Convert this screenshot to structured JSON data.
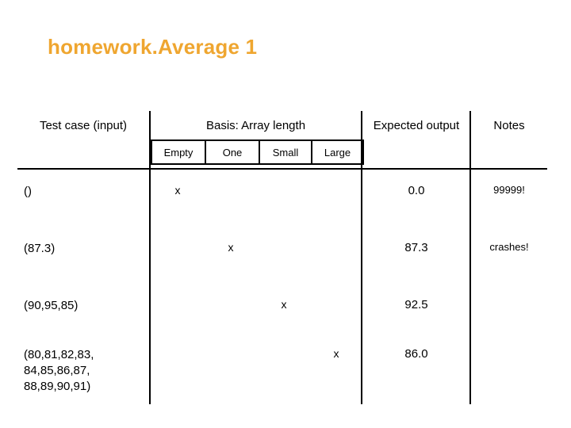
{
  "slide": {
    "title": "homework.Average 1",
    "title_color": "#efa630"
  },
  "table": {
    "headers": {
      "test_case": "Test case\n(input)",
      "basis": "Basis: Array length",
      "expected_output": "Expected\noutput",
      "notes": "Notes"
    },
    "basis_columns": [
      {
        "key": "empty",
        "label": "Empty"
      },
      {
        "key": "one",
        "label": "One"
      },
      {
        "key": "small",
        "label": "Small"
      },
      {
        "key": "large",
        "label": "Large"
      }
    ],
    "mark_glyph": "x",
    "rows": [
      {
        "test_case": "()",
        "basis": "empty",
        "marks": {
          "empty": "x",
          "one": "",
          "small": "",
          "large": ""
        },
        "expected_output": "0.0",
        "notes": "99999!"
      },
      {
        "test_case": "(87.3)",
        "basis": "one",
        "marks": {
          "empty": "",
          "one": "x",
          "small": "",
          "large": ""
        },
        "expected_output": "87.3",
        "notes": "crashes!"
      },
      {
        "test_case": "(90,95,85)",
        "basis": "small",
        "marks": {
          "empty": "",
          "one": "",
          "small": "x",
          "large": ""
        },
        "expected_output": "92.5",
        "notes": ""
      },
      {
        "test_case": "(80,81,82,83,\n 84,85,86,87,\n 88,89,90,91)",
        "basis": "large",
        "marks": {
          "empty": "",
          "one": "",
          "small": "",
          "large": "x"
        },
        "expected_output": "86.0",
        "notes": ""
      }
    ]
  }
}
